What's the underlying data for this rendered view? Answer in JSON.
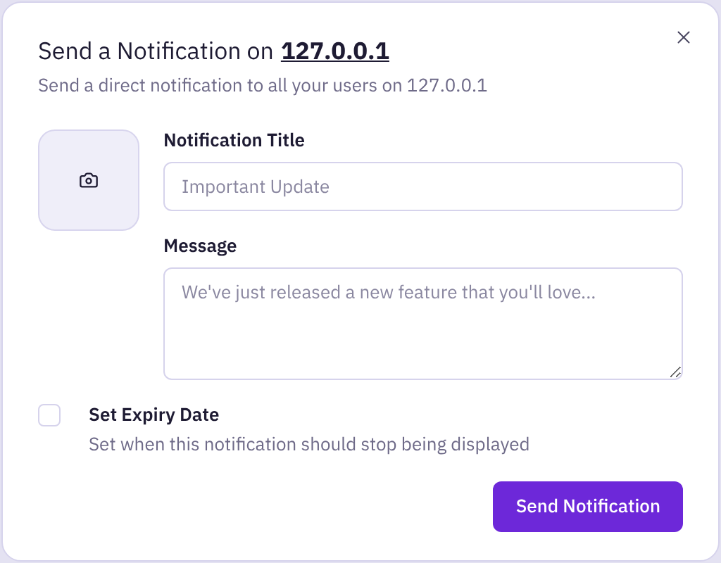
{
  "dialog": {
    "title": "Send a Notification on",
    "host": "127.0.0.1",
    "subtitle": "Send a direct notification to all your users on 127.0.0.1"
  },
  "fields": [
    {
      "kind": "input",
      "label": "Notification Title",
      "placeholder": "Important Update"
    },
    {
      "kind": "textarea",
      "label": "Message",
      "placeholder": "We've just released a new feature that you'll love..."
    }
  ],
  "expiry": {
    "label": "Set Expiry Date",
    "description": "Set when this notification should stop being displayed",
    "checked": false
  },
  "buttons": [
    "Send Notification"
  ]
}
